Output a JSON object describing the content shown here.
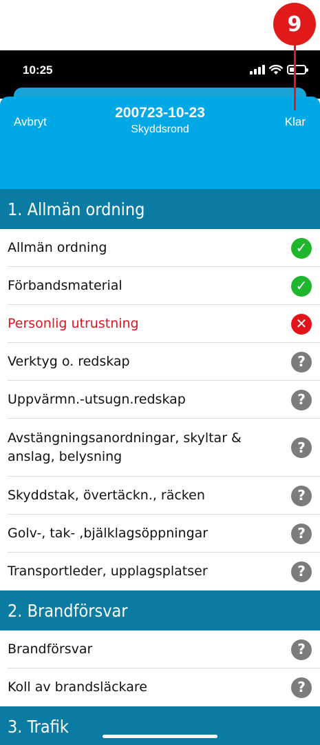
{
  "callout": {
    "number": "9"
  },
  "status_bar": {
    "time": "10:25",
    "battery_level": 0.35
  },
  "header": {
    "cancel_label": "Avbryt",
    "done_label": "Klar",
    "title": "200723-10-23",
    "subtitle": "Skyddsrond"
  },
  "sections": [
    {
      "title": "1. Allmän ordning",
      "items": [
        {
          "label": "Allmän ordning",
          "status": "ok"
        },
        {
          "label": "Förbandsmaterial",
          "status": "ok"
        },
        {
          "label": "Personlig utrustning",
          "status": "fail"
        },
        {
          "label": "Verktyg o. redskap",
          "status": "unknown"
        },
        {
          "label": "Uppvärmn.-utsugn.redskap",
          "status": "unknown"
        },
        {
          "label": "Avstängningsanordningar, skyltar & anslag, belysning",
          "status": "unknown"
        },
        {
          "label": "Skyddstak, övertäckn., räcken",
          "status": "unknown"
        },
        {
          "label": "Golv-, tak- ,bjälklagsöppningar",
          "status": "unknown"
        },
        {
          "label": "Transportleder, upplagsplatser",
          "status": "unknown"
        }
      ]
    },
    {
      "title": "2. Brandförsvar",
      "items": [
        {
          "label": "Brandförsvar",
          "status": "unknown"
        },
        {
          "label": "Koll av brandsläckare",
          "status": "unknown"
        }
      ]
    },
    {
      "title": "3. Trafik",
      "items": []
    }
  ],
  "status_icons": {
    "ok": "✓",
    "fail": "✕",
    "unknown": "?"
  },
  "colors": {
    "accent": "#00a9e6",
    "section_header": "#0a7ca3",
    "ok": "#1fb52d",
    "fail": "#e3131c",
    "unknown": "#7c7c7c",
    "callout": "#e11a1a"
  }
}
